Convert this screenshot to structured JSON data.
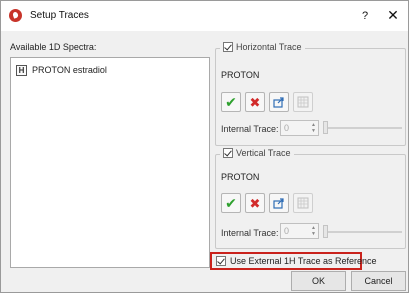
{
  "window": {
    "title": "Setup Traces",
    "help_glyph": "?",
    "close_glyph": "✕"
  },
  "spectra": {
    "label": "Available 1D Spectra:",
    "items": [
      {
        "icon": "H",
        "name": "PROTON estradiol"
      }
    ]
  },
  "horizontal": {
    "legend": "Horizontal Trace",
    "checked": true,
    "nucleus": "PROTON",
    "internal_label": "Internal Trace:",
    "internal_value": "0"
  },
  "vertical": {
    "legend": "Vertical Trace",
    "checked": true,
    "nucleus": "PROTON",
    "internal_label": "Internal Trace:",
    "internal_value": "0"
  },
  "external_ref": {
    "label": "Use External 1H Trace as Reference",
    "checked": true,
    "highlight_color": "#c9221c"
  },
  "buttons": {
    "ok": "OK",
    "cancel": "Cancel"
  },
  "colors": {
    "accept": "#2ea12e",
    "reject": "#d22b2b",
    "app_icon": "#c8342a"
  }
}
